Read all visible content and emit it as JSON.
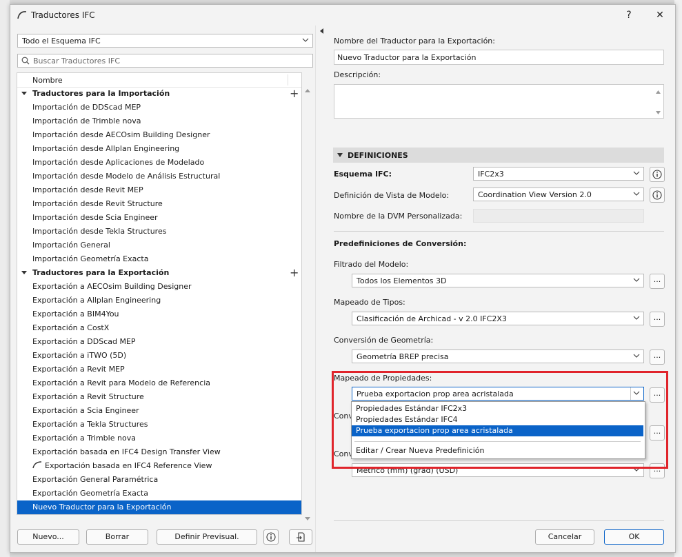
{
  "window": {
    "title": "Traductores IFC",
    "help_label": "?",
    "close_label": "✕"
  },
  "left": {
    "scheme_filter": "Todo el Esquema IFC",
    "search_placeholder": "Buscar Traductores IFC",
    "column_header": "Nombre",
    "groups": [
      {
        "label": "Traductores para la Importación",
        "items": [
          "Importación de DDScad MEP",
          "Importación de Trimble nova",
          "Importación desde AECOsim Building Designer",
          "Importación desde Allplan Engineering",
          "Importación desde Aplicaciones de Modelado",
          "Importación desde Modelo de Análisis Estructural",
          "Importación desde Revit MEP",
          "Importación desde Revit Structure",
          "Importación desde Scia Engineer",
          "Importación desde Tekla Structures",
          "Importación General",
          "Importación Geometría Exacta"
        ]
      },
      {
        "label": "Traductores para la Exportación",
        "items": [
          "Exportación a AECOsim Building Designer",
          "Exportación a Allplan Engineering",
          "Exportación a BIM4You",
          "Exportación a CostX",
          "Exportación a DDScad MEP",
          "Exportación a iTWO (5D)",
          "Exportación a Revit MEP",
          "Exportación a Revit para Modelo de Referencia",
          "Exportación a Revit Structure",
          "Exportación a Scia Engineer",
          "Exportación a Tekla Structures",
          "Exportación a Trimble nova",
          "Exportación basada en IFC4 Design Transfer View",
          "Exportación basada en IFC4 Reference View",
          "Exportación General Paramétrica",
          "Exportación Geometría Exacta",
          "Nuevo Traductor para la Exportación"
        ]
      }
    ],
    "buttons": {
      "new": "Nuevo...",
      "delete": "Borrar",
      "set_preview": "Definir Previsual."
    }
  },
  "right": {
    "name_label": "Nombre del Traductor para la Exportación:",
    "name_value": "Nuevo Traductor para la Exportación",
    "description_label": "Descripción:",
    "description_value": "",
    "section_title": "DEFINICIONES",
    "ifc_scheme_label": "Esquema IFC:",
    "ifc_scheme_value": "IFC2x3",
    "mvd_label": "Definición de Vista de Modelo:",
    "mvd_value": "Coordination View Version 2.0",
    "custom_mvd_label": "Nombre de la DVM Personalizada:",
    "presets_label": "Predefiniciones de Conversión:",
    "model_filter_label": "Filtrado del Modelo:",
    "model_filter_value": "Todos los Elementos 3D",
    "type_mapping_label": "Mapeado de Tipos:",
    "type_mapping_value": "Clasificación de Archicad - v 2.0 IFC2X3",
    "geometry_label": "Conversión de Geometría:",
    "geometry_value": "Geometría BREP precisa",
    "property_mapping_label": "Mapeado de Propiedades:",
    "property_mapping_value": "Prueba exportacion prop area acristalada",
    "hidden_label_1": "Conv",
    "hidden_label_2": "Conv",
    "units_value": "Métrico (mm) (grad) (USD)",
    "dots": "...",
    "popup_options": [
      "Propiedades Estándar IFC2x3",
      "Propiedades Estándar IFC4",
      "Prueba exportacion prop area acristalada"
    ],
    "popup_edit": "Editar / Crear Nueva Predefinición",
    "cancel": "Cancelar",
    "ok": "OK"
  },
  "colors": {
    "selection": "#0a63c8",
    "highlight_box": "#e0242b"
  }
}
